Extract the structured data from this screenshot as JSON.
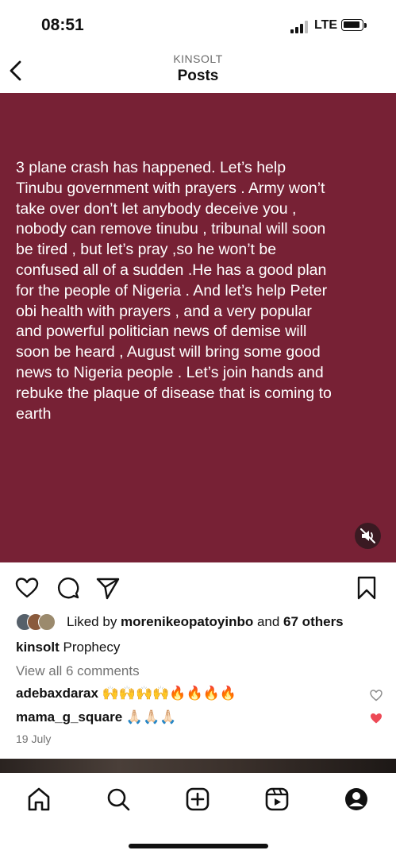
{
  "status_bar": {
    "time": "08:51",
    "network": "LTE"
  },
  "header": {
    "username": "KINSOLT",
    "title": "Posts"
  },
  "post": {
    "text": "3 plane crash has happened.   Let’s help\nTinubu government with prayers .  Army won’t\ntake over don’t let anybody deceive you ,\nnobody can remove tinubu , tribunal will soon\nbe tired , but let’s pray ,so he won’t be\nconfused all of a sudden .He has a good plan\nfor the people of Nigeria .  And let’s help Peter\nobi health with prayers , and a very popular\nand powerful politician news of demise will\nsoon be heard , August will bring some good\nnews to Nigeria people .  Let’s join hands and\nrebuke the plaque of disease that is coming to\nearth",
    "background_color": "#772135"
  },
  "likes": {
    "prefix": "Liked by ",
    "user": "morenikeopatoyinbo",
    "middle": " and ",
    "others": "67 others"
  },
  "caption": {
    "user": "kinsolt",
    "text": " Prophecy"
  },
  "view_comments": "View all 6 comments",
  "comments": [
    {
      "user": "adebaxdarax",
      "text": " 🙌🙌🙌🙌🔥🔥🔥🔥",
      "liked": false
    },
    {
      "user": "mama_g_square",
      "text": " 🙏🏻🙏🏻🙏🏻",
      "liked": true
    }
  ],
  "date": "19 July",
  "icons": {
    "back": "chevron-left-icon",
    "mute": "speaker-muted-icon",
    "like": "heart-outline-icon",
    "comment": "comment-bubble-icon",
    "share": "paper-plane-icon",
    "save": "bookmark-icon",
    "tabs": [
      "home-icon",
      "search-icon",
      "add-post-icon",
      "reels-icon",
      "profile-icon"
    ]
  },
  "colors": {
    "liked_heart": "#ed4956",
    "muted_text": "#737373"
  }
}
